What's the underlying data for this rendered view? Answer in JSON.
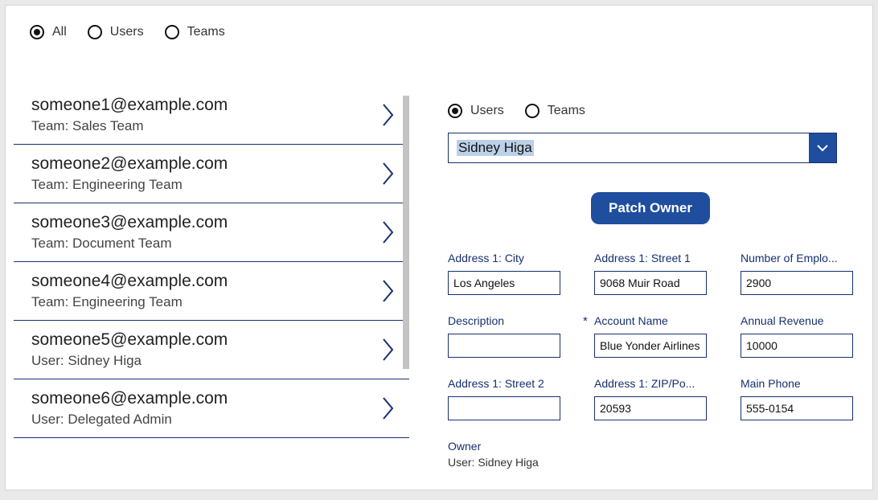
{
  "filters": {
    "left": [
      {
        "label": "All",
        "selected": true
      },
      {
        "label": "Users",
        "selected": false
      },
      {
        "label": "Teams",
        "selected": false
      }
    ],
    "detail": [
      {
        "label": "Users",
        "selected": true
      },
      {
        "label": "Teams",
        "selected": false
      }
    ]
  },
  "list": {
    "items": [
      {
        "primary": "someone1@example.com",
        "secondary": "Team: Sales Team"
      },
      {
        "primary": "someone2@example.com",
        "secondary": "Team: Engineering Team"
      },
      {
        "primary": "someone3@example.com",
        "secondary": "Team: Document Team"
      },
      {
        "primary": "someone4@example.com",
        "secondary": "Team: Engineering Team"
      },
      {
        "primary": "someone5@example.com",
        "secondary": "User: Sidney Higa"
      },
      {
        "primary": "someone6@example.com",
        "secondary": "User: Delegated Admin"
      }
    ]
  },
  "owner_select": {
    "value": "Sidney Higa"
  },
  "buttons": {
    "patch_owner": "Patch Owner"
  },
  "fields": [
    {
      "label": "Address 1: City",
      "value": "Los Angeles",
      "required": false
    },
    {
      "label": "Address 1: Street 1",
      "value": "9068 Muir Road",
      "required": false
    },
    {
      "label": "Number of Emplo...",
      "value": "2900",
      "required": false
    },
    {
      "label": "Description",
      "value": "",
      "required": false
    },
    {
      "label": "Account Name",
      "value": "Blue Yonder Airlines",
      "required": true
    },
    {
      "label": "Annual Revenue",
      "value": "10000",
      "required": false
    },
    {
      "label": "Address 1: Street 2",
      "value": "",
      "required": false
    },
    {
      "label": "Address 1: ZIP/Po...",
      "value": "20593",
      "required": false
    },
    {
      "label": "Main Phone",
      "value": "555-0154",
      "required": false
    }
  ],
  "owner": {
    "label": "Owner",
    "value": "User: Sidney Higa"
  }
}
